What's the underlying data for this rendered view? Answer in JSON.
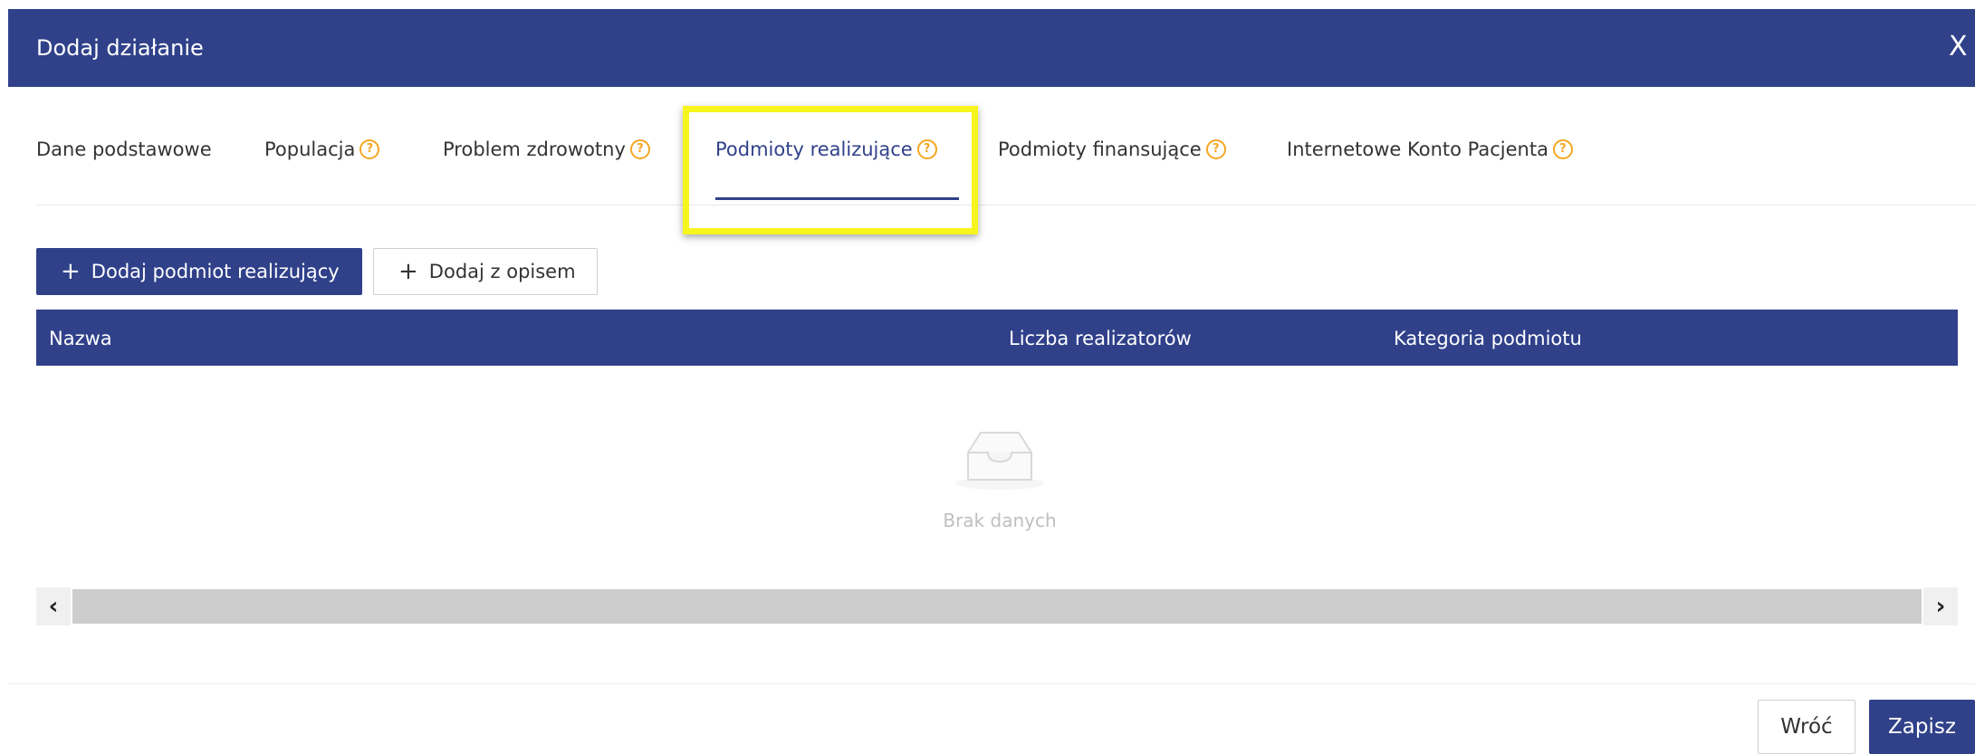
{
  "dialog": {
    "title": "Dodaj działanie",
    "close_label": "X"
  },
  "tabs": [
    {
      "label": "Dane podstawowe",
      "help": false
    },
    {
      "label": "Populacja",
      "help": true
    },
    {
      "label": "Problem zdrowotny",
      "help": true
    },
    {
      "label": "Podmioty realizujące",
      "help": true,
      "active": true
    },
    {
      "label": "Podmioty finansujące",
      "help": true
    },
    {
      "label": "Internetowe Konto Pacjenta",
      "help": true
    }
  ],
  "help_icon_glyph": "?",
  "actions": {
    "add_entity_label": "Dodaj podmiot realizujący",
    "add_with_description_label": "Dodaj z opisem",
    "plus_glyph": "+"
  },
  "table": {
    "columns": [
      "Nazwa",
      "Liczba realizatorów",
      "Kategoria podmiotu"
    ],
    "rows": [],
    "empty_text": "Brak danych"
  },
  "scrollbar": {
    "left_glyph": "‹",
    "right_glyph": "›"
  },
  "footer": {
    "back_label": "Wróć",
    "save_label": "Zapisz"
  },
  "colors": {
    "primary": "#30418a",
    "help_icon": "#f5a623",
    "highlight": "#f7f51e",
    "empty_text": "#bfbfbf"
  }
}
